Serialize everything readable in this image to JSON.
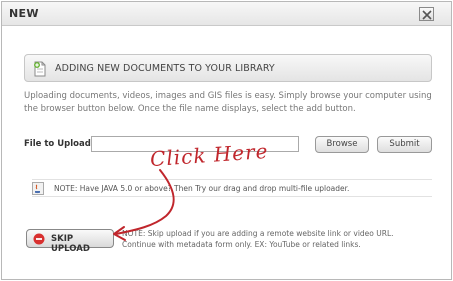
{
  "dialog": {
    "title": "NEW",
    "close_icon": "close-icon"
  },
  "section": {
    "icon": "add-document-icon",
    "title": "ADDING NEW DOCUMENTS TO YOUR LIBRARY"
  },
  "intro_text": "Uploading documents, videos, images and GIS files is easy. Simply browse your computer using the browser button below. Once the file name displays, select the add button.",
  "upload": {
    "label": "File to Upload",
    "value": "",
    "browse_label": "Browse",
    "submit_label": "Submit"
  },
  "java_note": {
    "icon": "java-icon",
    "text": "NOTE: Have JAVA 5.0 or above? Then Try our drag and drop multi-file uploader."
  },
  "skip": {
    "icon": "skip-icon",
    "label": "SKIP UPLOAD",
    "note": "NOTE: Skip upload if you are adding a remote website link or video URL. Continue with metadata form only. EX: YouTube or related links."
  },
  "annotation": {
    "text": "Click Here",
    "color": "#c0262c"
  }
}
